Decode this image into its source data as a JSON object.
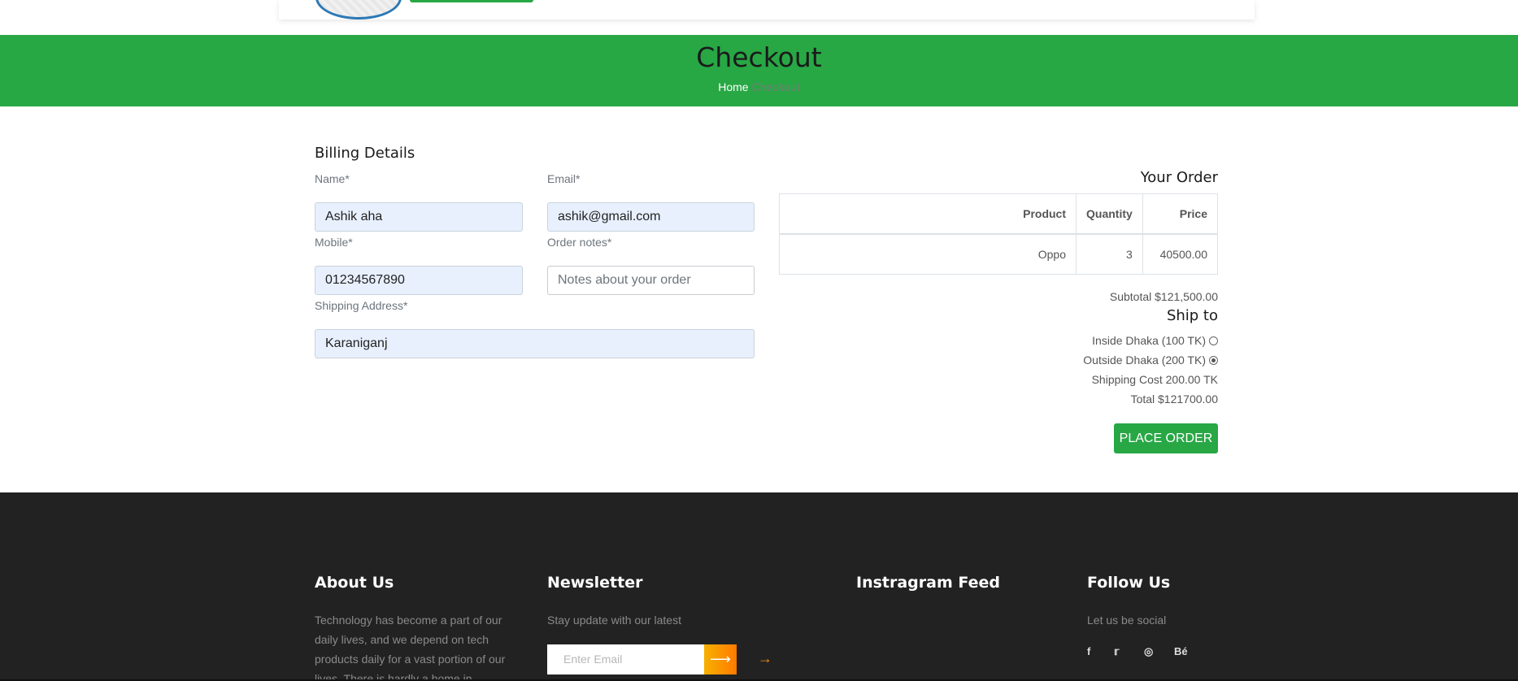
{
  "banner": {
    "title": "Checkout",
    "breadcrumb_home": "Home",
    "breadcrumb_current": "Checkout"
  },
  "billing": {
    "heading": "Billing Details",
    "name_label": "Name*",
    "name_value": "Ashik aha",
    "email_label": "Email*",
    "email_value": "ashik@gmail.com",
    "mobile_label": "Mobile*",
    "mobile_value": "01234567890",
    "notes_label": "Order notes*",
    "notes_placeholder": "Notes about your order",
    "address_label": "Shipping Address*",
    "address_value": "Karaniganj"
  },
  "order": {
    "heading": "Your Order",
    "columns": [
      "Product",
      "Quantity",
      "Price"
    ],
    "rows": [
      {
        "product": "Oppo",
        "quantity": "3",
        "price": "40500.00"
      }
    ],
    "subtotal": "Subtotal $121,500.00",
    "ship_heading": "Ship to",
    "ship_options": [
      {
        "label": "Inside Dhaka (100 TK)",
        "selected": false
      },
      {
        "label": "Outside Dhaka (200 TK)",
        "selected": true
      }
    ],
    "shipping_cost": "Shipping Cost 200.00 TK",
    "total": "Total $121700.00",
    "place_order_label": "PLACE ORDER"
  },
  "footer": {
    "about_heading": "About Us",
    "about_text": "Technology has become a part of our daily lives, and we depend on tech products daily for a vast portion of our lives. There is hardly a home in",
    "newsletter_heading": "Newsletter",
    "newsletter_text": "Stay update with our latest",
    "email_placeholder": "Enter Email",
    "instagram_heading": "Instragram Feed",
    "follow_heading": "Follow Us",
    "follow_text": "Let us be social",
    "social_icons": [
      "facebook-icon",
      "twitter-icon",
      "dribbble-icon",
      "behance-icon"
    ]
  },
  "colors": {
    "accent": "#28a745",
    "footer_bg": "#222222",
    "newsletter_btn": "#ff8c00"
  }
}
